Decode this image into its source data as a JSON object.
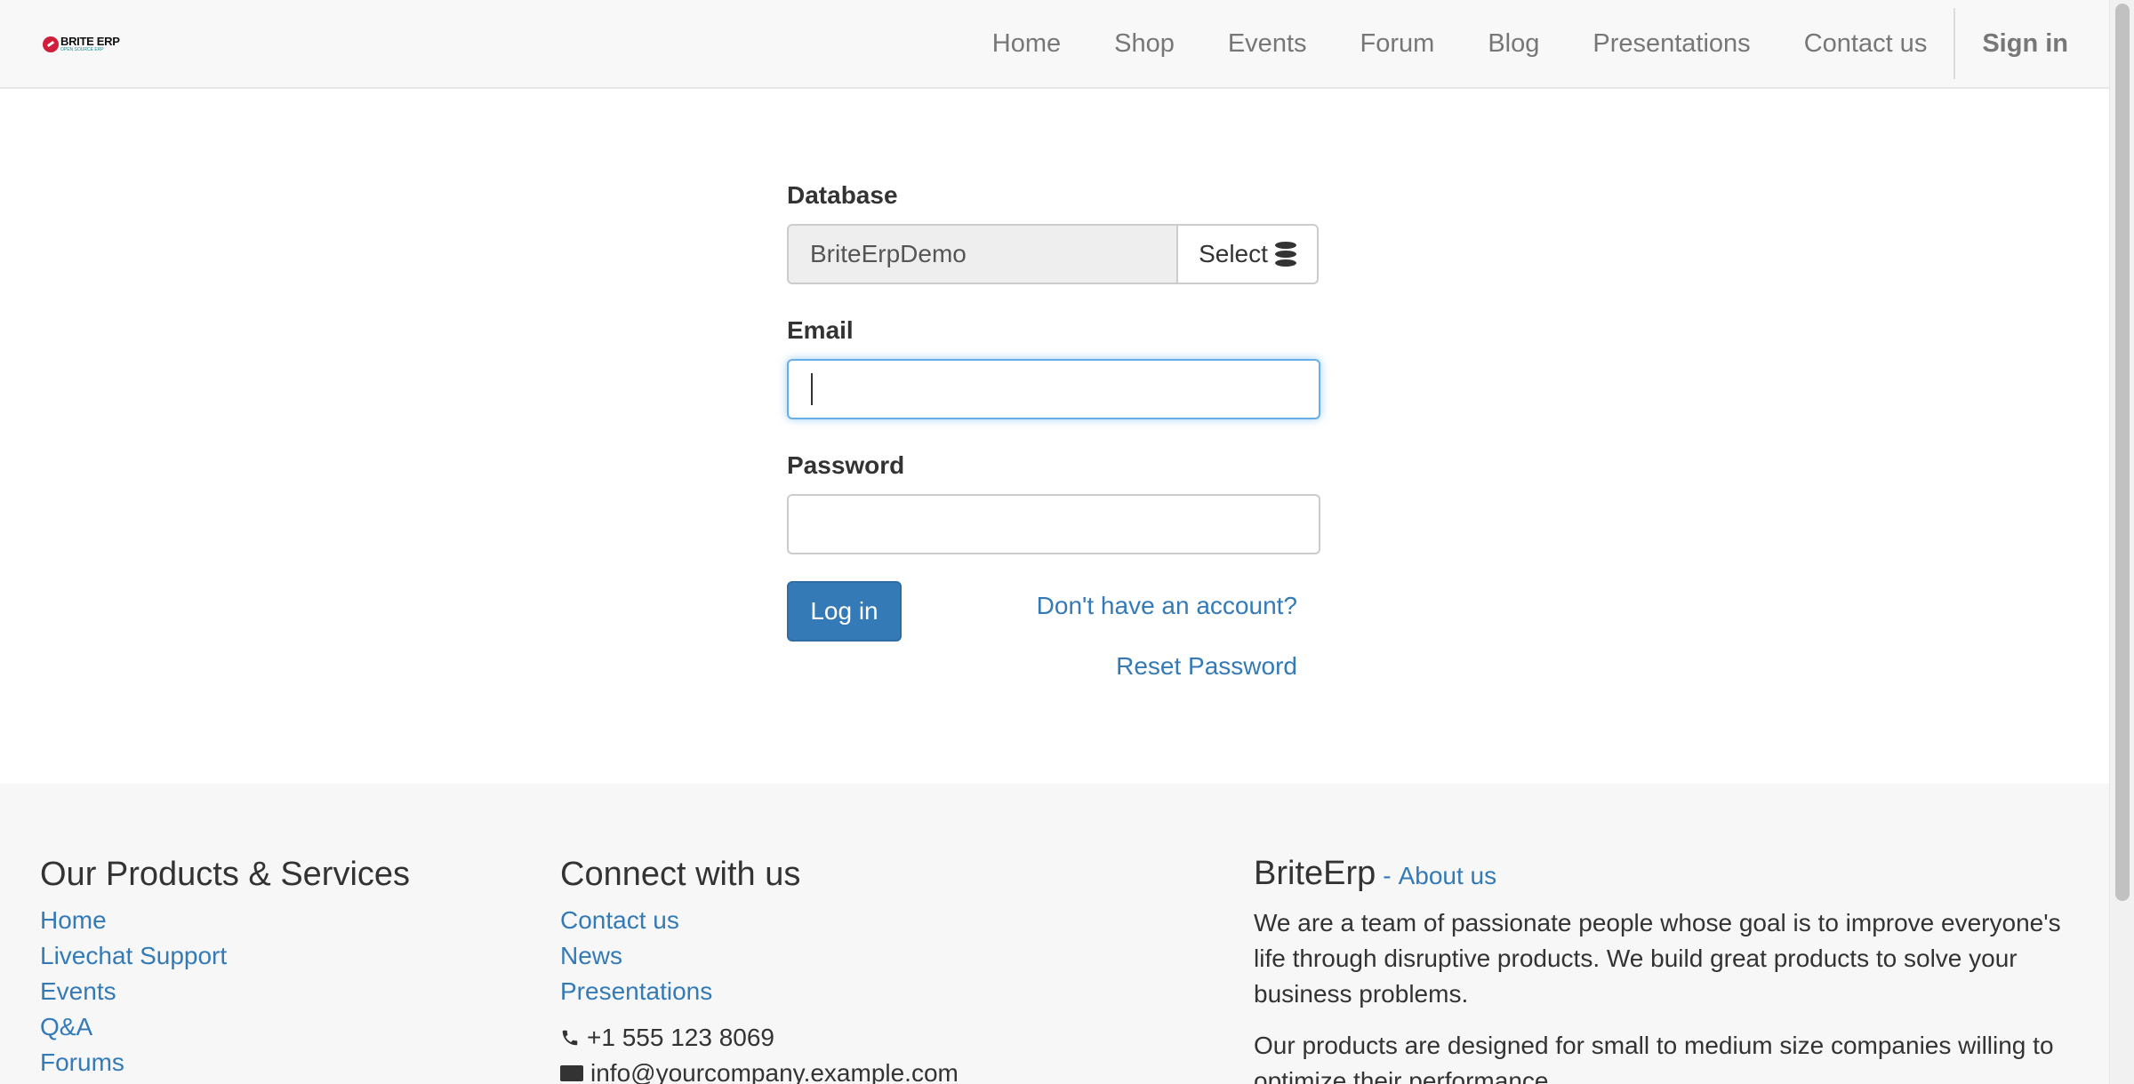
{
  "brand": {
    "logo_text": "BRITE ERP",
    "logo_tagline": "OPEN SOURCE ERP"
  },
  "nav": {
    "items": [
      "Home",
      "Shop",
      "Events",
      "Forum",
      "Blog",
      "Presentations",
      "Contact us"
    ],
    "signin_label": "Sign in"
  },
  "login": {
    "database_label": "Database",
    "database_value": "BriteErpDemo",
    "select_label": "Select",
    "select_icon": "database-icon",
    "email_label": "Email",
    "email_value": "",
    "password_label": "Password",
    "password_value": "",
    "login_button": "Log in",
    "signup_link": "Don't have an account?",
    "reset_link": "Reset Password"
  },
  "footer": {
    "products": {
      "title": "Our Products & Services",
      "links": [
        "Home",
        "Livechat Support",
        "Events",
        "Q&A",
        "Forums"
      ]
    },
    "connect": {
      "title": "Connect with us",
      "links": [
        "Contact us",
        "News",
        "Presentations"
      ],
      "phone_icon": "phone-icon",
      "phone": "+1 555 123 8069",
      "email_icon": "envelope-icon",
      "email": "info@yourcompany.example.com"
    },
    "about": {
      "title": "BriteErp",
      "separator": "-",
      "link": "About us",
      "paragraphs": [
        "We are a team of passionate people whose goal is to improve everyone's life through disruptive products. We build great products to solve your business problems.",
        "Our products are designed for small to medium size companies willing to optimize their performance."
      ]
    }
  },
  "colors": {
    "link": "#337ab7",
    "primary_button": "#337ab7",
    "navbar_bg": "#f8f8f8",
    "footer_bg": "#f7f7f7"
  }
}
